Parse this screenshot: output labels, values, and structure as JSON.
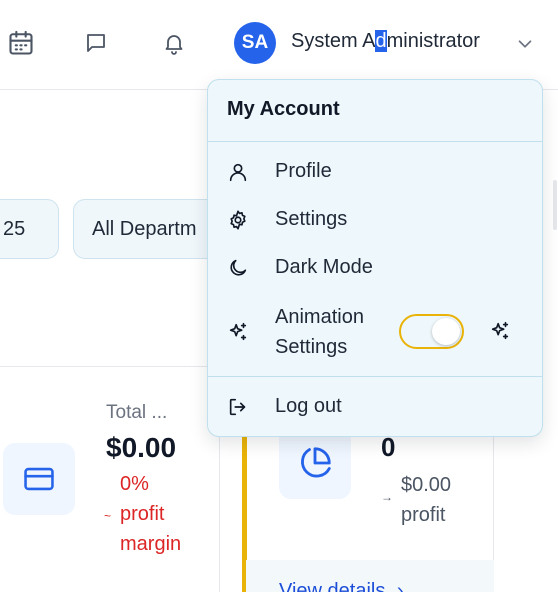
{
  "header": {
    "avatar_initials": "SA",
    "user_name_before": "System A",
    "user_name_selected": "d",
    "user_name_after": "ministrator",
    "icons": [
      "calendar-icon",
      "message-icon",
      "bell-icon",
      "chevron-down-icon"
    ]
  },
  "filters": {
    "date_fragment": "25",
    "department": "All Departm"
  },
  "cards": {
    "left": {
      "label": "Total ...",
      "value": "$0.00",
      "margin_pct": "0%",
      "margin_line1": "profit",
      "margin_line2": "margin",
      "icon": "credit-card-icon"
    },
    "right": {
      "value": "0",
      "sub_line1": "$0.00",
      "sub_line2": "profit",
      "link": "View details",
      "icon": "pie-chart-icon"
    }
  },
  "menu": {
    "title": "My Account",
    "items": [
      {
        "label": "Profile",
        "icon": "user-icon"
      },
      {
        "label": "Settings",
        "icon": "gear-icon"
      },
      {
        "label": "Dark Mode",
        "icon": "moon-icon"
      },
      {
        "label_line1": "Animation",
        "label_line2": "Settings",
        "icon": "sparkles-icon",
        "toggle_on": true
      },
      {
        "label": "Log out",
        "icon": "logout-icon"
      }
    ]
  },
  "colors": {
    "accent": "#2563eb",
    "toggle_border": "#eab308",
    "danger": "#dc2626",
    "menu_bg": "#eef7fb"
  }
}
